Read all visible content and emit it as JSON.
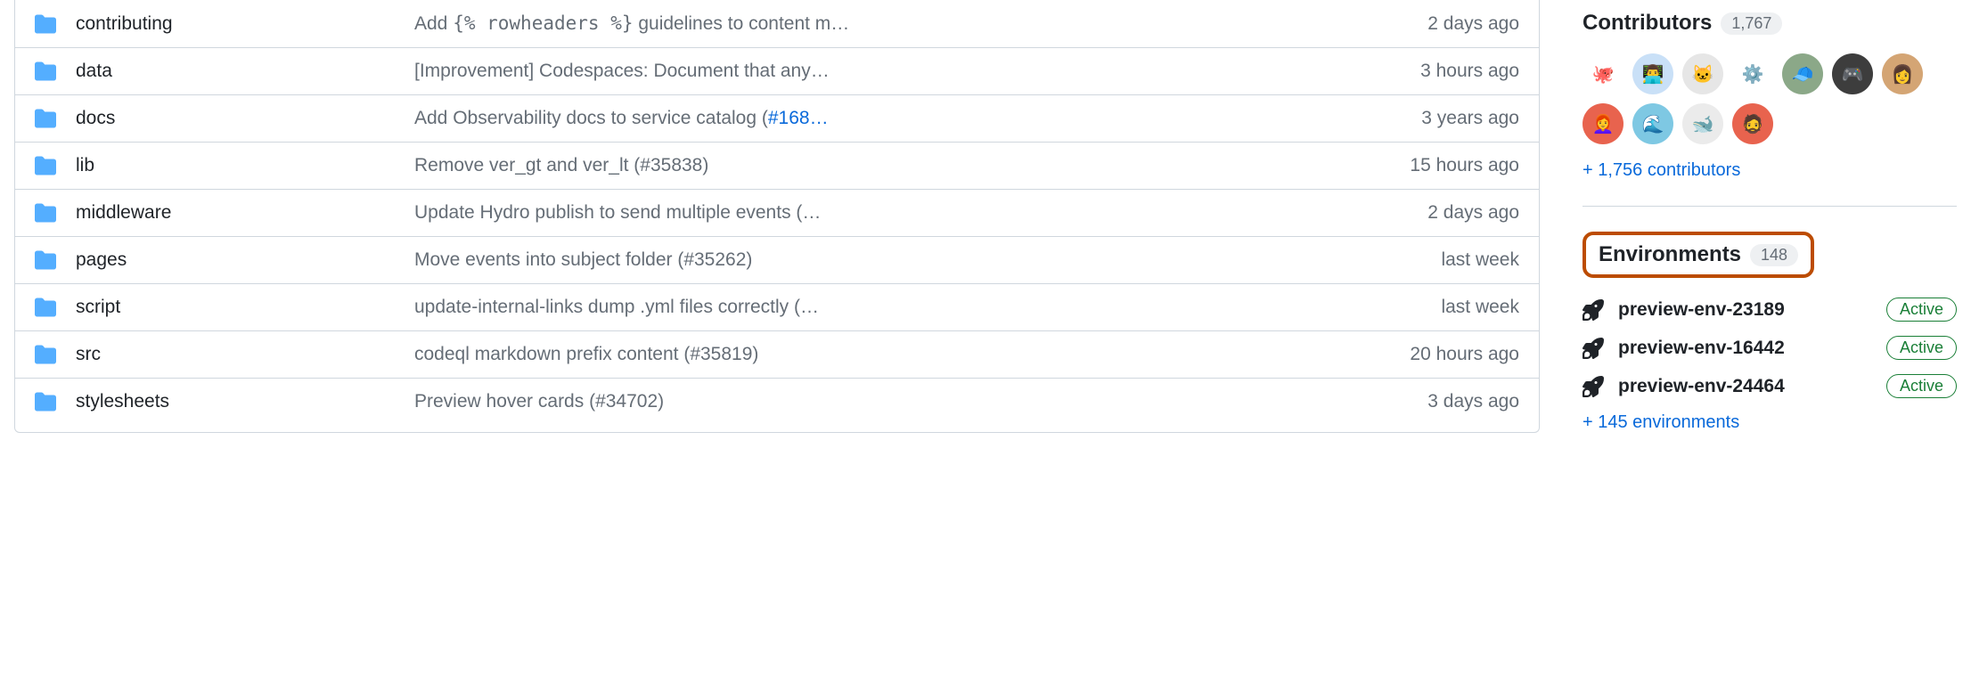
{
  "files": [
    {
      "name": "contributing",
      "msg_pre": "Add ",
      "msg_mono": "{% rowheaders %}",
      "msg_post": " guidelines to content m…",
      "time": "2 days ago"
    },
    {
      "name": "data",
      "msg_pre": "[Improvement] Codespaces: Document that any…",
      "msg_mono": "",
      "msg_post": "",
      "time": "3 hours ago"
    },
    {
      "name": "docs",
      "msg_pre": "Add Observability docs to service catalog (",
      "issue": "#168…",
      "msg_post": "",
      "time": "3 years ago"
    },
    {
      "name": "lib",
      "msg_pre": "Remove ver_gt and ver_lt (#35838)",
      "msg_mono": "",
      "msg_post": "",
      "time": "15 hours ago"
    },
    {
      "name": "middleware",
      "msg_pre": "Update Hydro publish to send multiple events (…",
      "msg_mono": "",
      "msg_post": "",
      "time": "2 days ago"
    },
    {
      "name": "pages",
      "msg_pre": "Move events into subject folder (#35262)",
      "msg_mono": "",
      "msg_post": "",
      "time": "last week"
    },
    {
      "name": "script",
      "msg_pre": "update-internal-links dump .yml files correctly (…",
      "msg_mono": "",
      "msg_post": "",
      "time": "last week"
    },
    {
      "name": "src",
      "msg_pre": "codeql markdown prefix content (#35819)",
      "msg_mono": "",
      "msg_post": "",
      "time": "20 hours ago"
    },
    {
      "name": "stylesheets",
      "msg_pre": "Preview hover cards (#34702)",
      "msg_mono": "",
      "msg_post": "",
      "time": "3 days ago"
    }
  ],
  "contributors": {
    "title": "Contributors",
    "count": "1,767",
    "avatars": [
      {
        "bg": "#ffffff",
        "emoji": "🐙"
      },
      {
        "bg": "#c9e0f7",
        "emoji": "👨‍💻"
      },
      {
        "bg": "#e6e6e6",
        "emoji": "🐱"
      },
      {
        "bg": "#ffffff",
        "emoji": "⚙️"
      },
      {
        "bg": "#8ba888",
        "emoji": "🧢"
      },
      {
        "bg": "#3d3d3d",
        "emoji": "🎮"
      },
      {
        "bg": "#d4a574",
        "emoji": "👩"
      },
      {
        "bg": "#e8634e",
        "emoji": "👩‍🦰"
      },
      {
        "bg": "#7ec8e3",
        "emoji": "🌊"
      },
      {
        "bg": "#ebebeb",
        "emoji": "🐋"
      },
      {
        "bg": "#e8634e",
        "emoji": "🧔"
      }
    ],
    "more": "+ 1,756 contributors"
  },
  "environments": {
    "title": "Environments",
    "count": "148",
    "items": [
      {
        "name": "preview-env-23189",
        "status": "Active"
      },
      {
        "name": "preview-env-16442",
        "status": "Active"
      },
      {
        "name": "preview-env-24464",
        "status": "Active"
      }
    ],
    "more": "+ 145 environments"
  }
}
